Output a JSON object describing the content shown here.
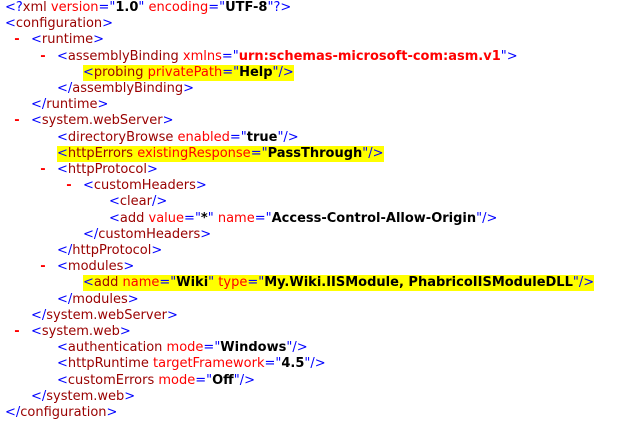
{
  "toggle_symbol": "-",
  "colors": {
    "bracket": "#0000FF",
    "element": "#990000",
    "attr_name": "#FF0000",
    "attr_value": "#000000",
    "toggle": "#FF0000",
    "highlight": "#FFFF00"
  },
  "lines": [
    {
      "indent": 0,
      "toggle": false,
      "highlight": false,
      "segments": [
        {
          "t": "bk",
          "v": "<?"
        },
        {
          "t": "el",
          "v": "xml"
        },
        {
          "t": "an",
          "v": " version"
        },
        {
          "t": "sm",
          "v": "=\""
        },
        {
          "t": "av",
          "v": "1.0"
        },
        {
          "t": "sm",
          "v": "\""
        },
        {
          "t": "an",
          "v": " encoding"
        },
        {
          "t": "sm",
          "v": "=\""
        },
        {
          "t": "av",
          "v": "UTF-8"
        },
        {
          "t": "sm",
          "v": "\""
        },
        {
          "t": "bk",
          "v": "?>"
        }
      ]
    },
    {
      "indent": 0,
      "toggle": false,
      "highlight": false,
      "segments": [
        {
          "t": "bk",
          "v": "<"
        },
        {
          "t": "el",
          "v": "configuration"
        },
        {
          "t": "bk",
          "v": ">"
        }
      ]
    },
    {
      "indent": 1,
      "toggle": true,
      "highlight": false,
      "segments": [
        {
          "t": "bk",
          "v": "<"
        },
        {
          "t": "el",
          "v": "runtime"
        },
        {
          "t": "bk",
          "v": ">"
        }
      ]
    },
    {
      "indent": 2,
      "toggle": true,
      "highlight": false,
      "segments": [
        {
          "t": "bk",
          "v": "<"
        },
        {
          "t": "el",
          "v": "assemblyBinding"
        },
        {
          "t": "an",
          "v": " xmlns"
        },
        {
          "t": "sm",
          "v": "=\""
        },
        {
          "t": "an-bold",
          "v": "urn:schemas-microsoft-com:asm.v1"
        },
        {
          "t": "sm",
          "v": "\""
        },
        {
          "t": "bk",
          "v": ">"
        }
      ]
    },
    {
      "indent": 3,
      "toggle": false,
      "highlight": true,
      "segments": [
        {
          "t": "bk",
          "v": "<"
        },
        {
          "t": "el",
          "v": "probing"
        },
        {
          "t": "an",
          "v": " privatePath"
        },
        {
          "t": "sm",
          "v": "=\""
        },
        {
          "t": "av",
          "v": "Help"
        },
        {
          "t": "sm",
          "v": "\""
        },
        {
          "t": "bk",
          "v": "/>"
        }
      ]
    },
    {
      "indent": 2,
      "toggle": false,
      "highlight": false,
      "segments": [
        {
          "t": "bk",
          "v": "</"
        },
        {
          "t": "el",
          "v": "assemblyBinding"
        },
        {
          "t": "bk",
          "v": ">"
        }
      ]
    },
    {
      "indent": 1,
      "toggle": false,
      "highlight": false,
      "segments": [
        {
          "t": "bk",
          "v": "</"
        },
        {
          "t": "el",
          "v": "runtime"
        },
        {
          "t": "bk",
          "v": ">"
        }
      ]
    },
    {
      "indent": 1,
      "toggle": true,
      "highlight": false,
      "segments": [
        {
          "t": "bk",
          "v": "<"
        },
        {
          "t": "el",
          "v": "system.webServer"
        },
        {
          "t": "bk",
          "v": ">"
        }
      ]
    },
    {
      "indent": 2,
      "toggle": false,
      "highlight": false,
      "segments": [
        {
          "t": "bk",
          "v": "<"
        },
        {
          "t": "el",
          "v": "directoryBrowse"
        },
        {
          "t": "an",
          "v": " enabled"
        },
        {
          "t": "sm",
          "v": "=\""
        },
        {
          "t": "av",
          "v": "true"
        },
        {
          "t": "sm",
          "v": "\""
        },
        {
          "t": "bk",
          "v": "/>"
        }
      ]
    },
    {
      "indent": 2,
      "toggle": false,
      "highlight": true,
      "segments": [
        {
          "t": "bk",
          "v": "<"
        },
        {
          "t": "el",
          "v": "httpErrors"
        },
        {
          "t": "an",
          "v": " existingResponse"
        },
        {
          "t": "sm",
          "v": "=\""
        },
        {
          "t": "av",
          "v": "PassThrough"
        },
        {
          "t": "sm",
          "v": "\""
        },
        {
          "t": "bk",
          "v": "/>"
        }
      ]
    },
    {
      "indent": 2,
      "toggle": true,
      "highlight": false,
      "segments": [
        {
          "t": "bk",
          "v": "<"
        },
        {
          "t": "el",
          "v": "httpProtocol"
        },
        {
          "t": "bk",
          "v": ">"
        }
      ]
    },
    {
      "indent": 3,
      "toggle": true,
      "highlight": false,
      "segments": [
        {
          "t": "bk",
          "v": "<"
        },
        {
          "t": "el",
          "v": "customHeaders"
        },
        {
          "t": "bk",
          "v": ">"
        }
      ]
    },
    {
      "indent": 4,
      "toggle": false,
      "highlight": false,
      "segments": [
        {
          "t": "bk",
          "v": "<"
        },
        {
          "t": "el",
          "v": "clear"
        },
        {
          "t": "bk",
          "v": "/>"
        }
      ]
    },
    {
      "indent": 4,
      "toggle": false,
      "highlight": false,
      "segments": [
        {
          "t": "bk",
          "v": "<"
        },
        {
          "t": "el",
          "v": "add"
        },
        {
          "t": "an",
          "v": " value"
        },
        {
          "t": "sm",
          "v": "=\""
        },
        {
          "t": "av",
          "v": "*"
        },
        {
          "t": "sm",
          "v": "\""
        },
        {
          "t": "an",
          "v": " name"
        },
        {
          "t": "sm",
          "v": "=\""
        },
        {
          "t": "av",
          "v": "Access-Control-Allow-Origin"
        },
        {
          "t": "sm",
          "v": "\""
        },
        {
          "t": "bk",
          "v": "/>"
        }
      ]
    },
    {
      "indent": 3,
      "toggle": false,
      "highlight": false,
      "segments": [
        {
          "t": "bk",
          "v": "</"
        },
        {
          "t": "el",
          "v": "customHeaders"
        },
        {
          "t": "bk",
          "v": ">"
        }
      ]
    },
    {
      "indent": 2,
      "toggle": false,
      "highlight": false,
      "segments": [
        {
          "t": "bk",
          "v": "</"
        },
        {
          "t": "el",
          "v": "httpProtocol"
        },
        {
          "t": "bk",
          "v": ">"
        }
      ]
    },
    {
      "indent": 2,
      "toggle": true,
      "highlight": false,
      "segments": [
        {
          "t": "bk",
          "v": "<"
        },
        {
          "t": "el",
          "v": "modules"
        },
        {
          "t": "bk",
          "v": ">"
        }
      ]
    },
    {
      "indent": 3,
      "toggle": false,
      "highlight": true,
      "segments": [
        {
          "t": "bk",
          "v": "<"
        },
        {
          "t": "el",
          "v": "add"
        },
        {
          "t": "an",
          "v": " name"
        },
        {
          "t": "sm",
          "v": "=\""
        },
        {
          "t": "av",
          "v": "Wiki"
        },
        {
          "t": "sm",
          "v": "\""
        },
        {
          "t": "an",
          "v": " type"
        },
        {
          "t": "sm",
          "v": "=\""
        },
        {
          "t": "av",
          "v": "My.Wiki.IISModule, PhabricoIISModuleDLL"
        },
        {
          "t": "sm",
          "v": "\""
        },
        {
          "t": "bk",
          "v": "/>"
        }
      ]
    },
    {
      "indent": 2,
      "toggle": false,
      "highlight": false,
      "segments": [
        {
          "t": "bk",
          "v": "</"
        },
        {
          "t": "el",
          "v": "modules"
        },
        {
          "t": "bk",
          "v": ">"
        }
      ]
    },
    {
      "indent": 1,
      "toggle": false,
      "highlight": false,
      "segments": [
        {
          "t": "bk",
          "v": "</"
        },
        {
          "t": "el",
          "v": "system.webServer"
        },
        {
          "t": "bk",
          "v": ">"
        }
      ]
    },
    {
      "indent": 1,
      "toggle": true,
      "highlight": false,
      "segments": [
        {
          "t": "bk",
          "v": "<"
        },
        {
          "t": "el",
          "v": "system.web"
        },
        {
          "t": "bk",
          "v": ">"
        }
      ]
    },
    {
      "indent": 2,
      "toggle": false,
      "highlight": false,
      "segments": [
        {
          "t": "bk",
          "v": "<"
        },
        {
          "t": "el",
          "v": "authentication"
        },
        {
          "t": "an",
          "v": " mode"
        },
        {
          "t": "sm",
          "v": "=\""
        },
        {
          "t": "av",
          "v": "Windows"
        },
        {
          "t": "sm",
          "v": "\""
        },
        {
          "t": "bk",
          "v": "/>"
        }
      ]
    },
    {
      "indent": 2,
      "toggle": false,
      "highlight": false,
      "segments": [
        {
          "t": "bk",
          "v": "<"
        },
        {
          "t": "el",
          "v": "httpRuntime"
        },
        {
          "t": "an",
          "v": " targetFramework"
        },
        {
          "t": "sm",
          "v": "=\""
        },
        {
          "t": "av",
          "v": "4.5"
        },
        {
          "t": "sm",
          "v": "\""
        },
        {
          "t": "bk",
          "v": "/>"
        }
      ]
    },
    {
      "indent": 2,
      "toggle": false,
      "highlight": false,
      "segments": [
        {
          "t": "bk",
          "v": "<"
        },
        {
          "t": "el",
          "v": "customErrors"
        },
        {
          "t": "an",
          "v": " mode"
        },
        {
          "t": "sm",
          "v": "=\""
        },
        {
          "t": "av",
          "v": "Off"
        },
        {
          "t": "sm",
          "v": "\""
        },
        {
          "t": "bk",
          "v": "/>"
        }
      ]
    },
    {
      "indent": 1,
      "toggle": false,
      "highlight": false,
      "segments": [
        {
          "t": "bk",
          "v": "</"
        },
        {
          "t": "el",
          "v": "system.web"
        },
        {
          "t": "bk",
          "v": ">"
        }
      ]
    },
    {
      "indent": 0,
      "toggle": false,
      "highlight": false,
      "segments": [
        {
          "t": "bk",
          "v": "</"
        },
        {
          "t": "el",
          "v": "configuration"
        },
        {
          "t": "bk",
          "v": ">"
        }
      ]
    }
  ]
}
